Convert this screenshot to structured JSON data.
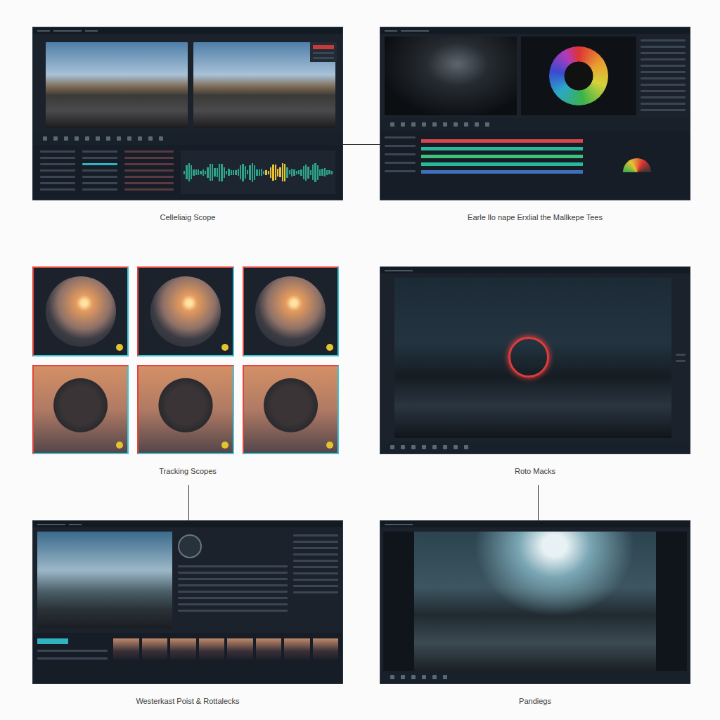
{
  "panels": [
    {
      "label": "Celleliaig Scope",
      "kind": "dual-viewer"
    },
    {
      "label": "Earle llo nape Erxlial the Mallkepe Tees",
      "kind": "color-wheel"
    },
    {
      "label": "Tracking Scopes",
      "kind": "thumb-grid"
    },
    {
      "label": "Roto Macks",
      "kind": "roto"
    },
    {
      "label": "Westerkast Poist & Rottalecks",
      "kind": "filmstrip"
    },
    {
      "label": "Pandiegs",
      "kind": "render"
    }
  ]
}
